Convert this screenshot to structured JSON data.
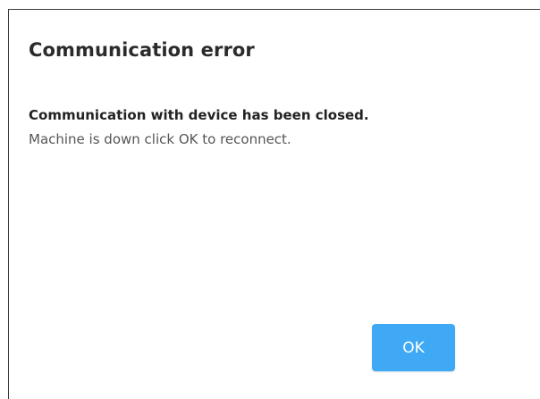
{
  "dialog": {
    "title": "Communication error",
    "message_strong": "Communication with device has been closed.",
    "message_detail": "Machine is down click OK to reconnect.",
    "ok_label": "OK"
  },
  "colors": {
    "button_background": "#3fa9f5",
    "button_text": "#ffffff",
    "border": "#3a3a3a"
  }
}
